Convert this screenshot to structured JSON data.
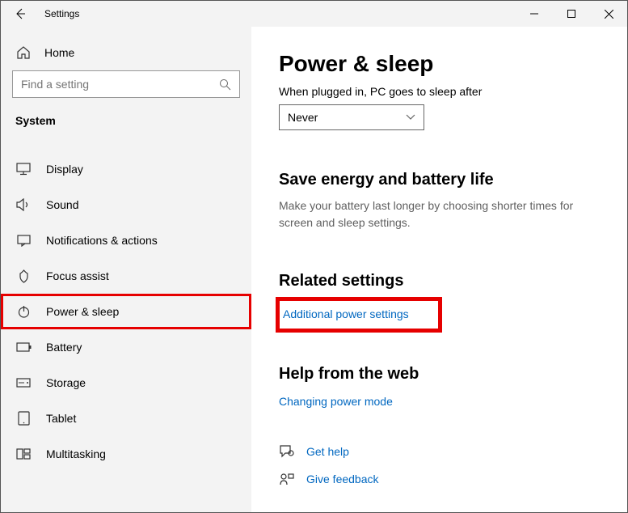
{
  "window": {
    "title": "Settings"
  },
  "sidebar": {
    "home_label": "Home",
    "search_placeholder": "Find a setting",
    "category": "System",
    "items": [
      {
        "label": "Display",
        "icon": "display-icon",
        "selected": false
      },
      {
        "label": "Sound",
        "icon": "sound-icon",
        "selected": false
      },
      {
        "label": "Notifications & actions",
        "icon": "notifications-icon",
        "selected": false
      },
      {
        "label": "Focus assist",
        "icon": "focus-assist-icon",
        "selected": false
      },
      {
        "label": "Power & sleep",
        "icon": "power-icon",
        "selected": true
      },
      {
        "label": "Battery",
        "icon": "battery-icon",
        "selected": false
      },
      {
        "label": "Storage",
        "icon": "storage-icon",
        "selected": false
      },
      {
        "label": "Tablet",
        "icon": "tablet-icon",
        "selected": false
      },
      {
        "label": "Multitasking",
        "icon": "multitasking-icon",
        "selected": false
      }
    ]
  },
  "main": {
    "title": "Power & sleep",
    "sleep_label": "When plugged in, PC goes to sleep after",
    "sleep_value": "Never",
    "save_energy": {
      "heading": "Save energy and battery life",
      "body": "Make your battery last longer by choosing shorter times for screen and sleep settings."
    },
    "related": {
      "heading": "Related settings",
      "link": "Additional power settings"
    },
    "help": {
      "heading": "Help from the web",
      "link": "Changing power mode"
    },
    "footer": {
      "get_help": "Get help",
      "give_feedback": "Give feedback"
    }
  }
}
